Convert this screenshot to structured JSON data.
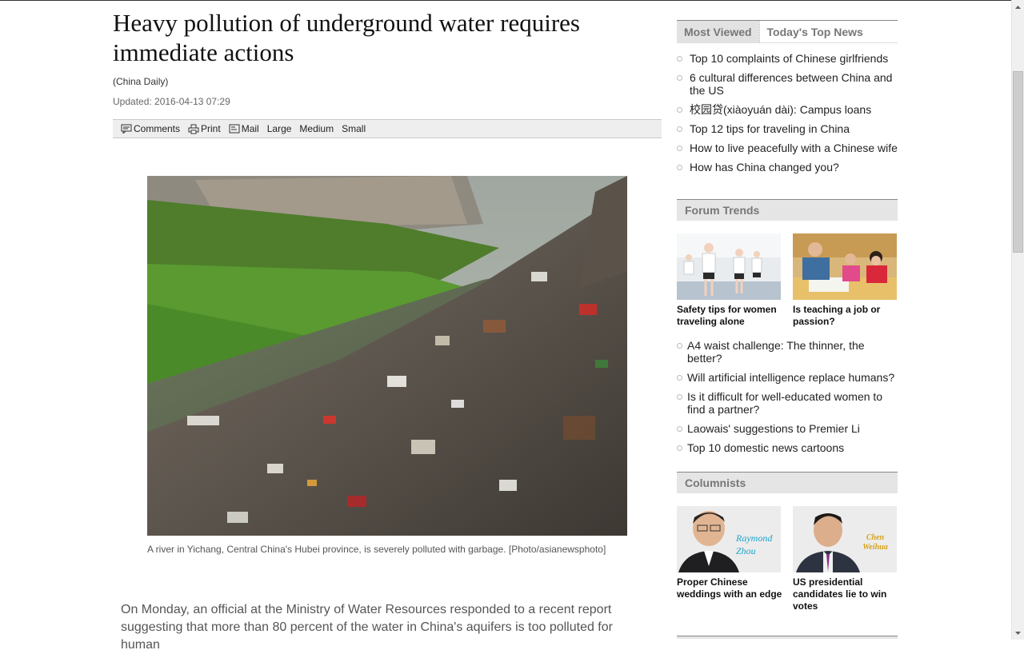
{
  "article": {
    "title": "Heavy pollution of underground water requires immediate actions",
    "source": "(China Daily)",
    "updated": "Updated: 2016-04-13 07:29",
    "toolbar": {
      "comments": "Comments",
      "print": "Print",
      "mail": "Mail",
      "large": "Large",
      "medium": "Medium",
      "small": "Small"
    },
    "caption": "A river in Yichang, Central China's Hubei province, is severely polluted with garbage. [Photo/asianewsphoto]",
    "body": "On Monday, an official at the Ministry of Water Resources responded to a recent report suggesting that more than 80 percent of the water in China's aquifers is too polluted for human"
  },
  "sidebar": {
    "tabs": [
      "Most Viewed",
      "Today's Top News"
    ],
    "most_viewed": [
      "Top 10 complaints of Chinese girlfriends",
      "6 cultural differences between China and the US",
      "校园贷(xiàoyuán dài): Campus loans",
      "Top 12 tips for traveling in China",
      "How to live peacefully with a Chinese wife",
      "How has China changed you?"
    ],
    "forum": {
      "heading": "Forum Trends",
      "features": [
        {
          "caption": "Safety tips for women traveling alone"
        },
        {
          "caption": "Is teaching a job or passion?"
        }
      ],
      "items": [
        "A4 waist challenge: The thinner, the better?",
        "Will artificial intelligence replace humans?",
        "Is it difficult for well-educated women to find a partner?",
        "Laowais' suggestions to Premier Li",
        "Top 10 domestic news cartoons"
      ]
    },
    "columnists": {
      "heading": "Columnists",
      "items": [
        {
          "name": "Raymond Zhou",
          "caption": "Proper Chinese weddings with an edge"
        },
        {
          "name": "Chen Weihua",
          "caption": "US presidential candidates lie to win votes"
        }
      ]
    }
  },
  "colors": {
    "tab_active_bg": "#e2e2e2",
    "section_head_bg": "#e5e5e5",
    "body_text": "#555555"
  }
}
